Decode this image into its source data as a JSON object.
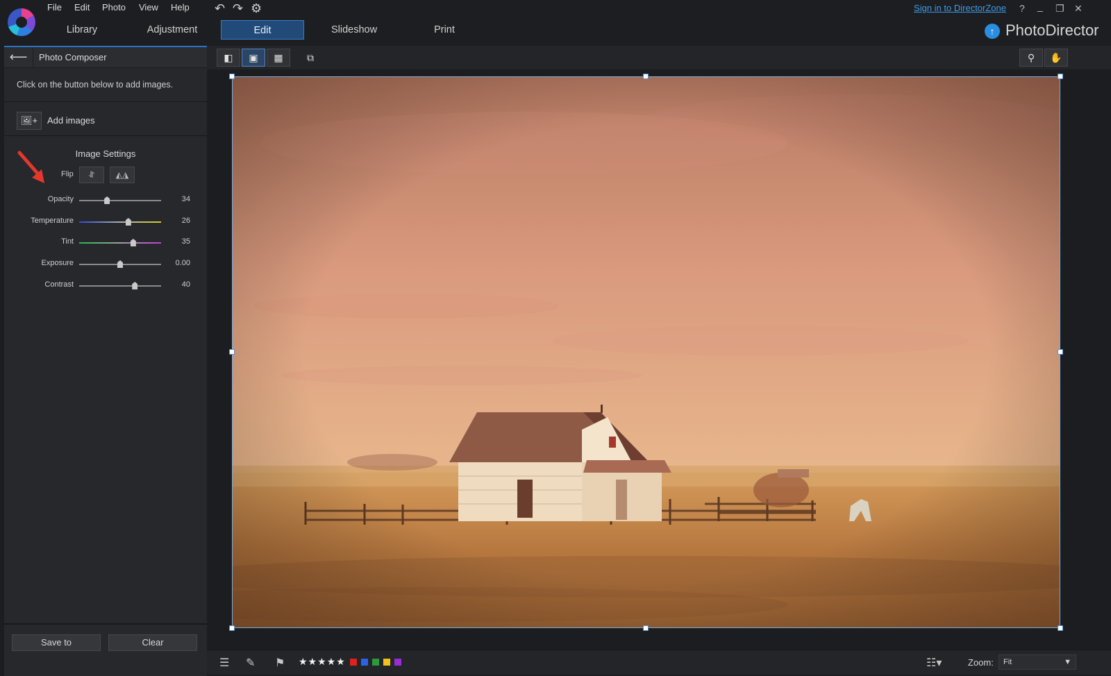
{
  "menu": {
    "file": "File",
    "edit": "Edit",
    "photo": "Photo",
    "view": "View",
    "help": "Help"
  },
  "modes": {
    "library": "Library",
    "adjustment": "Adjustment",
    "edit": "Edit",
    "slideshow": "Slideshow",
    "print": "Print"
  },
  "account": {
    "signin": "Sign in to DirectorZone"
  },
  "window_controls": {
    "help": "?",
    "minimize": "_",
    "restore": "❐",
    "close": "✕"
  },
  "brand": {
    "name": "PhotoDirector"
  },
  "panel": {
    "title": "Photo Composer",
    "instructions": "Click on the button below to add images.",
    "add_images": "Add images",
    "settings_title": "Image Settings",
    "flip_label": "Flip",
    "sliders": [
      {
        "label": "Opacity",
        "value": "34",
        "position": 0.34
      },
      {
        "label": "Temperature",
        "value": "26",
        "position": 0.6
      },
      {
        "label": "Tint",
        "value": "35",
        "position": 0.66
      },
      {
        "label": "Exposure",
        "value": "0.00",
        "position": 0.5
      },
      {
        "label": "Contrast",
        "value": "40",
        "position": 0.68
      }
    ],
    "save_to": "Save to",
    "clear": "Clear"
  },
  "ratings": {
    "stars": "★★★★★"
  },
  "color_labels": [
    "#e0211f",
    "#2b63e6",
    "#2c9a3b",
    "#f2c21b",
    "#9b2bd8"
  ],
  "zoom": {
    "label": "Zoom:",
    "value": "Fit"
  }
}
